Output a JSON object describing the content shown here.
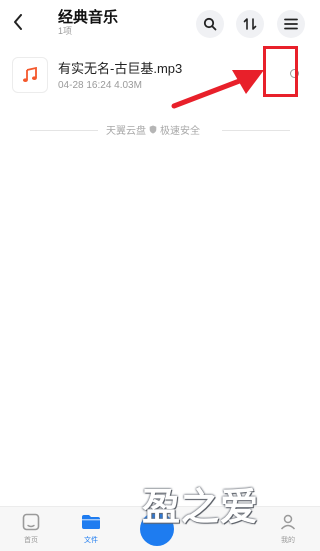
{
  "header": {
    "title": "经典音乐",
    "subtitle": "1项",
    "icons": {
      "back": "chevron-left-icon",
      "search": "search-icon",
      "sort": "sort-icon",
      "menu": "menu-icon"
    }
  },
  "file": {
    "name": "有实无名-古巨基.mp3",
    "meta": "04-28 16:24  4.03M",
    "icon": "music-note-icon",
    "icon_color": "#f4582c"
  },
  "footer_note": {
    "text_left": "天翼云盘",
    "text_right": "极速安全",
    "icon": "shield-icon"
  },
  "tabbar": {
    "tabs": [
      {
        "label": "首页",
        "icon": "home-icon"
      },
      {
        "label": "文件",
        "icon": "folder-icon",
        "active": true
      },
      {
        "label": "我的",
        "icon": "user-icon"
      }
    ],
    "accent": "#1e7cf0"
  },
  "annotation": {
    "box_color": "#e8202a"
  },
  "watermark": {
    "text": "盈之爱"
  }
}
